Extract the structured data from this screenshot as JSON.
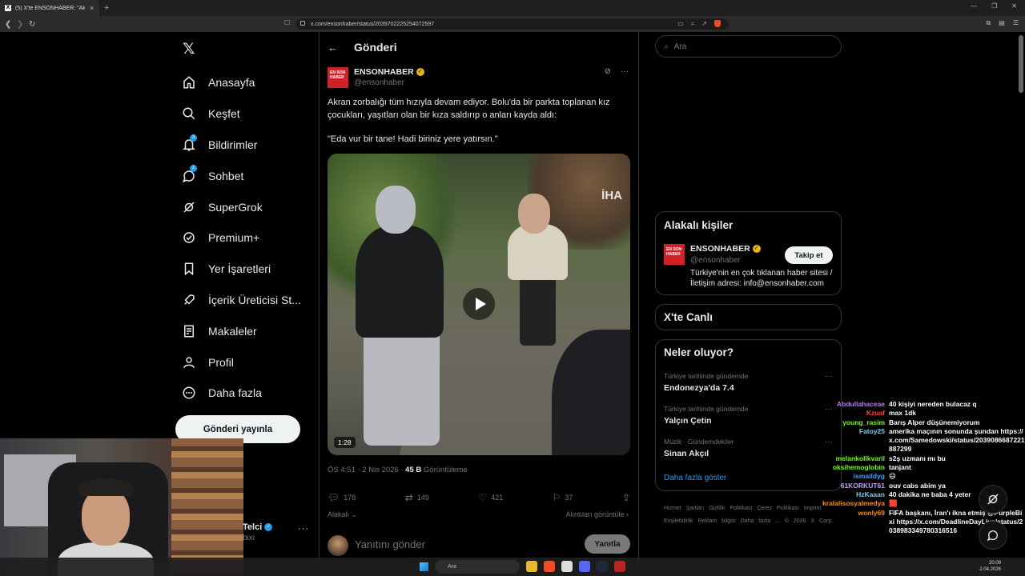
{
  "browser": {
    "tab_title": "(5) X'te ENSONHABER: \"Akran zo",
    "url": "x.com/ensonhaber/status/2039702225254072597"
  },
  "nav": {
    "items": [
      {
        "label": "Anasayfa",
        "icon": "home-icon"
      },
      {
        "label": "Keşfet",
        "icon": "search-icon"
      },
      {
        "label": "Bildirimler",
        "icon": "bell-icon",
        "badge": "3"
      },
      {
        "label": "Sohbet",
        "icon": "chat-icon",
        "badge": "2"
      },
      {
        "label": "SuperGrok",
        "icon": "grok-icon"
      },
      {
        "label": "Premium+",
        "icon": "premium-icon"
      },
      {
        "label": "Yer İşaretleri",
        "icon": "bookmark-icon"
      },
      {
        "label": "İçerik Üreticisi St...",
        "icon": "rocket-icon"
      },
      {
        "label": "Makaleler",
        "icon": "article-icon"
      },
      {
        "label": "Profil",
        "icon": "person-icon"
      },
      {
        "label": "Daha fazla",
        "icon": "more-circle-icon"
      }
    ],
    "post_button": "Gönderi yayınla",
    "account_name": "Telci",
    "account_handle": "bixi"
  },
  "post": {
    "header": "Gönderi",
    "author": "ENSONHABER",
    "handle": "@ensonhaber",
    "avatar_text": "EN SON HABER",
    "text": "Akran zorbalığı tüm hızıyla devam ediyor. Bolu'da bir parkta toplanan kız çocukları, yaşıtları olan bir kıza saldırıp o anları kayda aldı:",
    "quote": "\"Eda vur bir tane! Hadi biriniz yere yatırsın.\"",
    "watermark": "İHA",
    "duration": "1:28",
    "time": "ÖS 4:51 · 2 Nis 2026 ·",
    "views": "45 B",
    "views_label": "Görüntüleme",
    "replies": "178",
    "reposts": "149",
    "likes": "421",
    "bookmarks": "37",
    "relevant": "Alakalı",
    "quotes_link": "Alıntıları görüntüle",
    "reply_placeholder": "Yanıtını gönder",
    "reply_button": "Yanıtla"
  },
  "right": {
    "search_placeholder": "Ara",
    "related_title": "Alakalı kişiler",
    "related_name": "ENSONHABER",
    "related_handle": "@ensonhaber",
    "follow_button": "Takip et",
    "related_bio": "Türkiye'nin en çok tıklanan haber sitesi / İletişim adresi: info@ensonhaber.com",
    "live_title": "X'te Canlı",
    "trends_title": "Neler oluyor?",
    "trends": [
      {
        "context": "Türkiye tarihinde gündemde",
        "name": "Endonezya'da 7.4"
      },
      {
        "context": "Türkiye tarihinde gündemde",
        "name": "Yalçın Çetin"
      },
      {
        "context": "Müzik · Gündemdekiler",
        "name": "Sinan Akçıl"
      }
    ],
    "show_more": "Daha fazla göster",
    "footer": "Hizmet Şartları   Gizlilik Politikası   Çerez Politikası   Imprint   Erişilebilirlik   Reklam bilgisi   Daha fazla ...   © 2026 X Corp."
  },
  "chat": [
    {
      "user": "Abdullahaceae",
      "msg": "40 kişiyi nereden bulacaz q",
      "color": "#b57cf2"
    },
    {
      "user": "Kzuaf",
      "msg": "max 1dk",
      "color": "#ff4040"
    },
    {
      "user": "young_rasim",
      "msg": "Barış Alper düşünemiyorum",
      "color": "#7cfc00"
    },
    {
      "user": "Fatoy25",
      "msg": "amerika maçının sonunda şundan https://x.com/Samedowski/status/2039086687221887299",
      "color": "#7ec8e3"
    },
    {
      "user": "melankolikvaril",
      "msg": "s2ş uzmanı mı bu",
      "color": "#7cfc00"
    },
    {
      "user": "oksihemoglobin",
      "msg": "tanjant",
      "color": "#7cfc00"
    },
    {
      "user": "ismaildyg",
      "msg": "😄",
      "color": "#3ea1ff"
    },
    {
      "user": "61KORKUT61",
      "msg": "ouv cabs abim ya",
      "color": "#c5a3ff"
    },
    {
      "user": "HzKaaan",
      "msg": "40 dakika ne baba 4 yeter",
      "color": "#7ec8e3"
    },
    {
      "user": "kralalisosyalmedya",
      "msg": "🟥",
      "color": "#ff8c00"
    },
    {
      "user": "wonly69",
      "msg": "FIFA başkanı, İran'ı ikna etmiş @PurpleBixi https://x.com/DeadlineDayLive/status/2038983349780316516",
      "color": "#ff8c00"
    }
  ],
  "taskbar": {
    "search": "Ara",
    "time": "20:09",
    "date": "2.04.2026"
  }
}
